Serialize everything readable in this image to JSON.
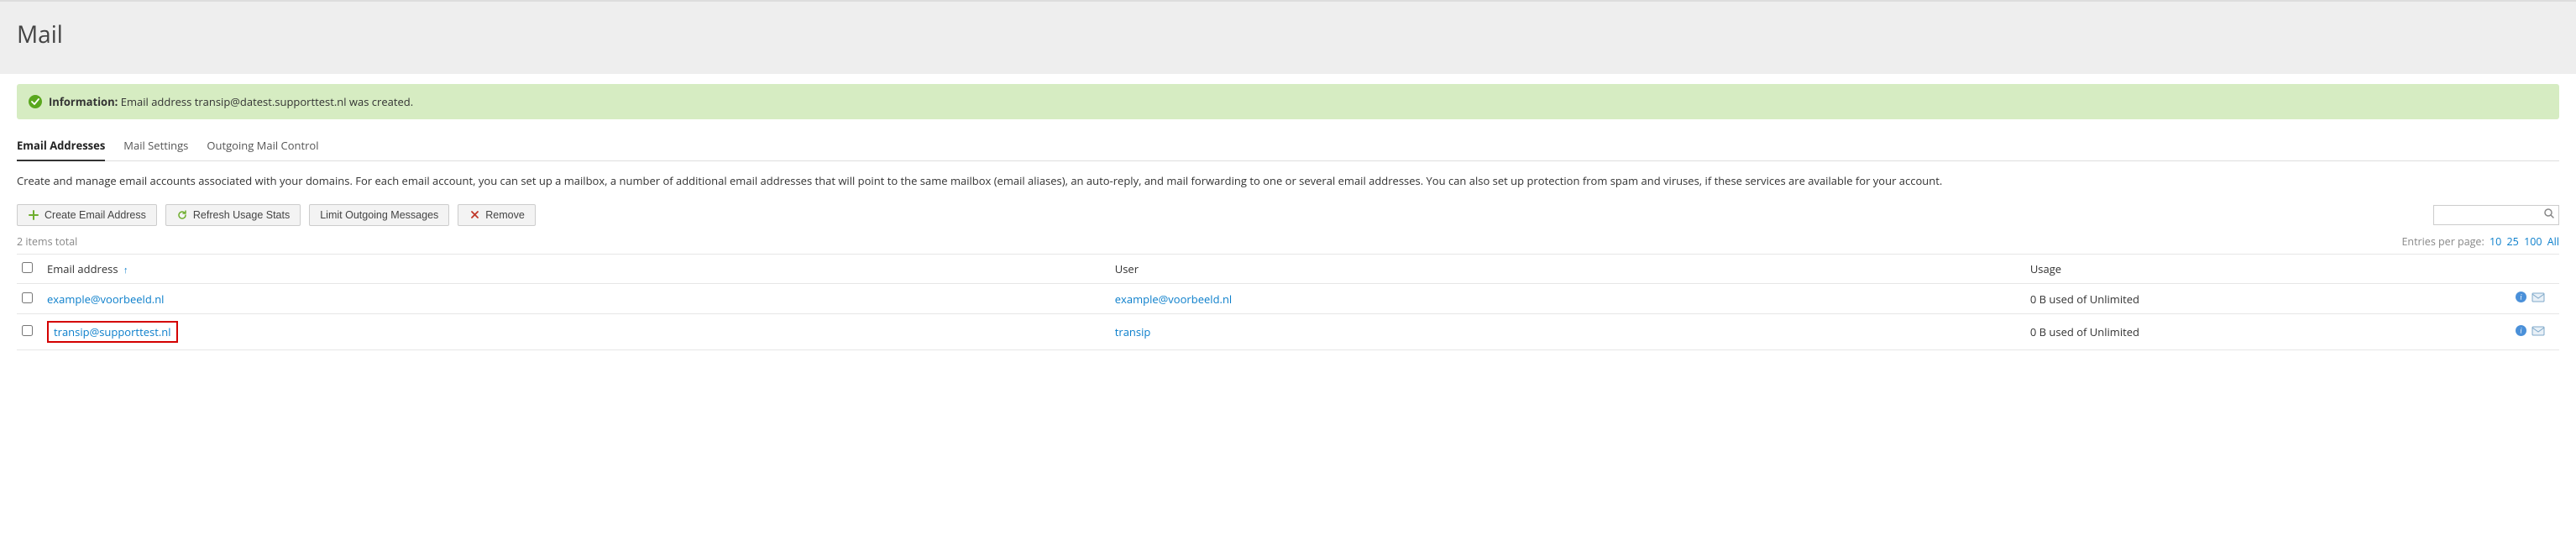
{
  "header": {
    "title": "Mail"
  },
  "alert": {
    "label": "Information:",
    "message": "Email address transip@datest.supporttest.nl was created."
  },
  "tabs": [
    {
      "id": "email-addresses",
      "label": "Email Addresses",
      "active": true
    },
    {
      "id": "mail-settings",
      "label": "Mail Settings",
      "active": false
    },
    {
      "id": "outgoing-mail-control",
      "label": "Outgoing Mail Control",
      "active": false
    }
  ],
  "description": "Create and manage email accounts associated with your domains. For each email account, you can set up a mailbox, a number of additional email addresses that will point to the same mailbox (email aliases), an auto-reply, and mail forwarding to one or several email addresses. You can also set up protection from spam and viruses, if these services are available for your account.",
  "toolbar": {
    "create": "Create Email Address",
    "refresh": "Refresh Usage Stats",
    "limit": "Limit Outgoing Messages",
    "remove": "Remove"
  },
  "search": {
    "placeholder": ""
  },
  "listing": {
    "total_text": "2 items total",
    "per_page_label": "Entries per page:",
    "per_page_options": [
      "10",
      "25",
      "100",
      "All"
    ],
    "columns": {
      "email": "Email address",
      "user": "User",
      "usage": "Usage"
    },
    "rows": [
      {
        "email": "example@voorbeeld.nl",
        "user": "example@voorbeeld.nl",
        "usage": "0 B used of Unlimited",
        "highlight": false
      },
      {
        "email": "transip@supporttest.nl",
        "user": "transip",
        "usage": "0 B used of Unlimited",
        "highlight": true
      }
    ]
  }
}
